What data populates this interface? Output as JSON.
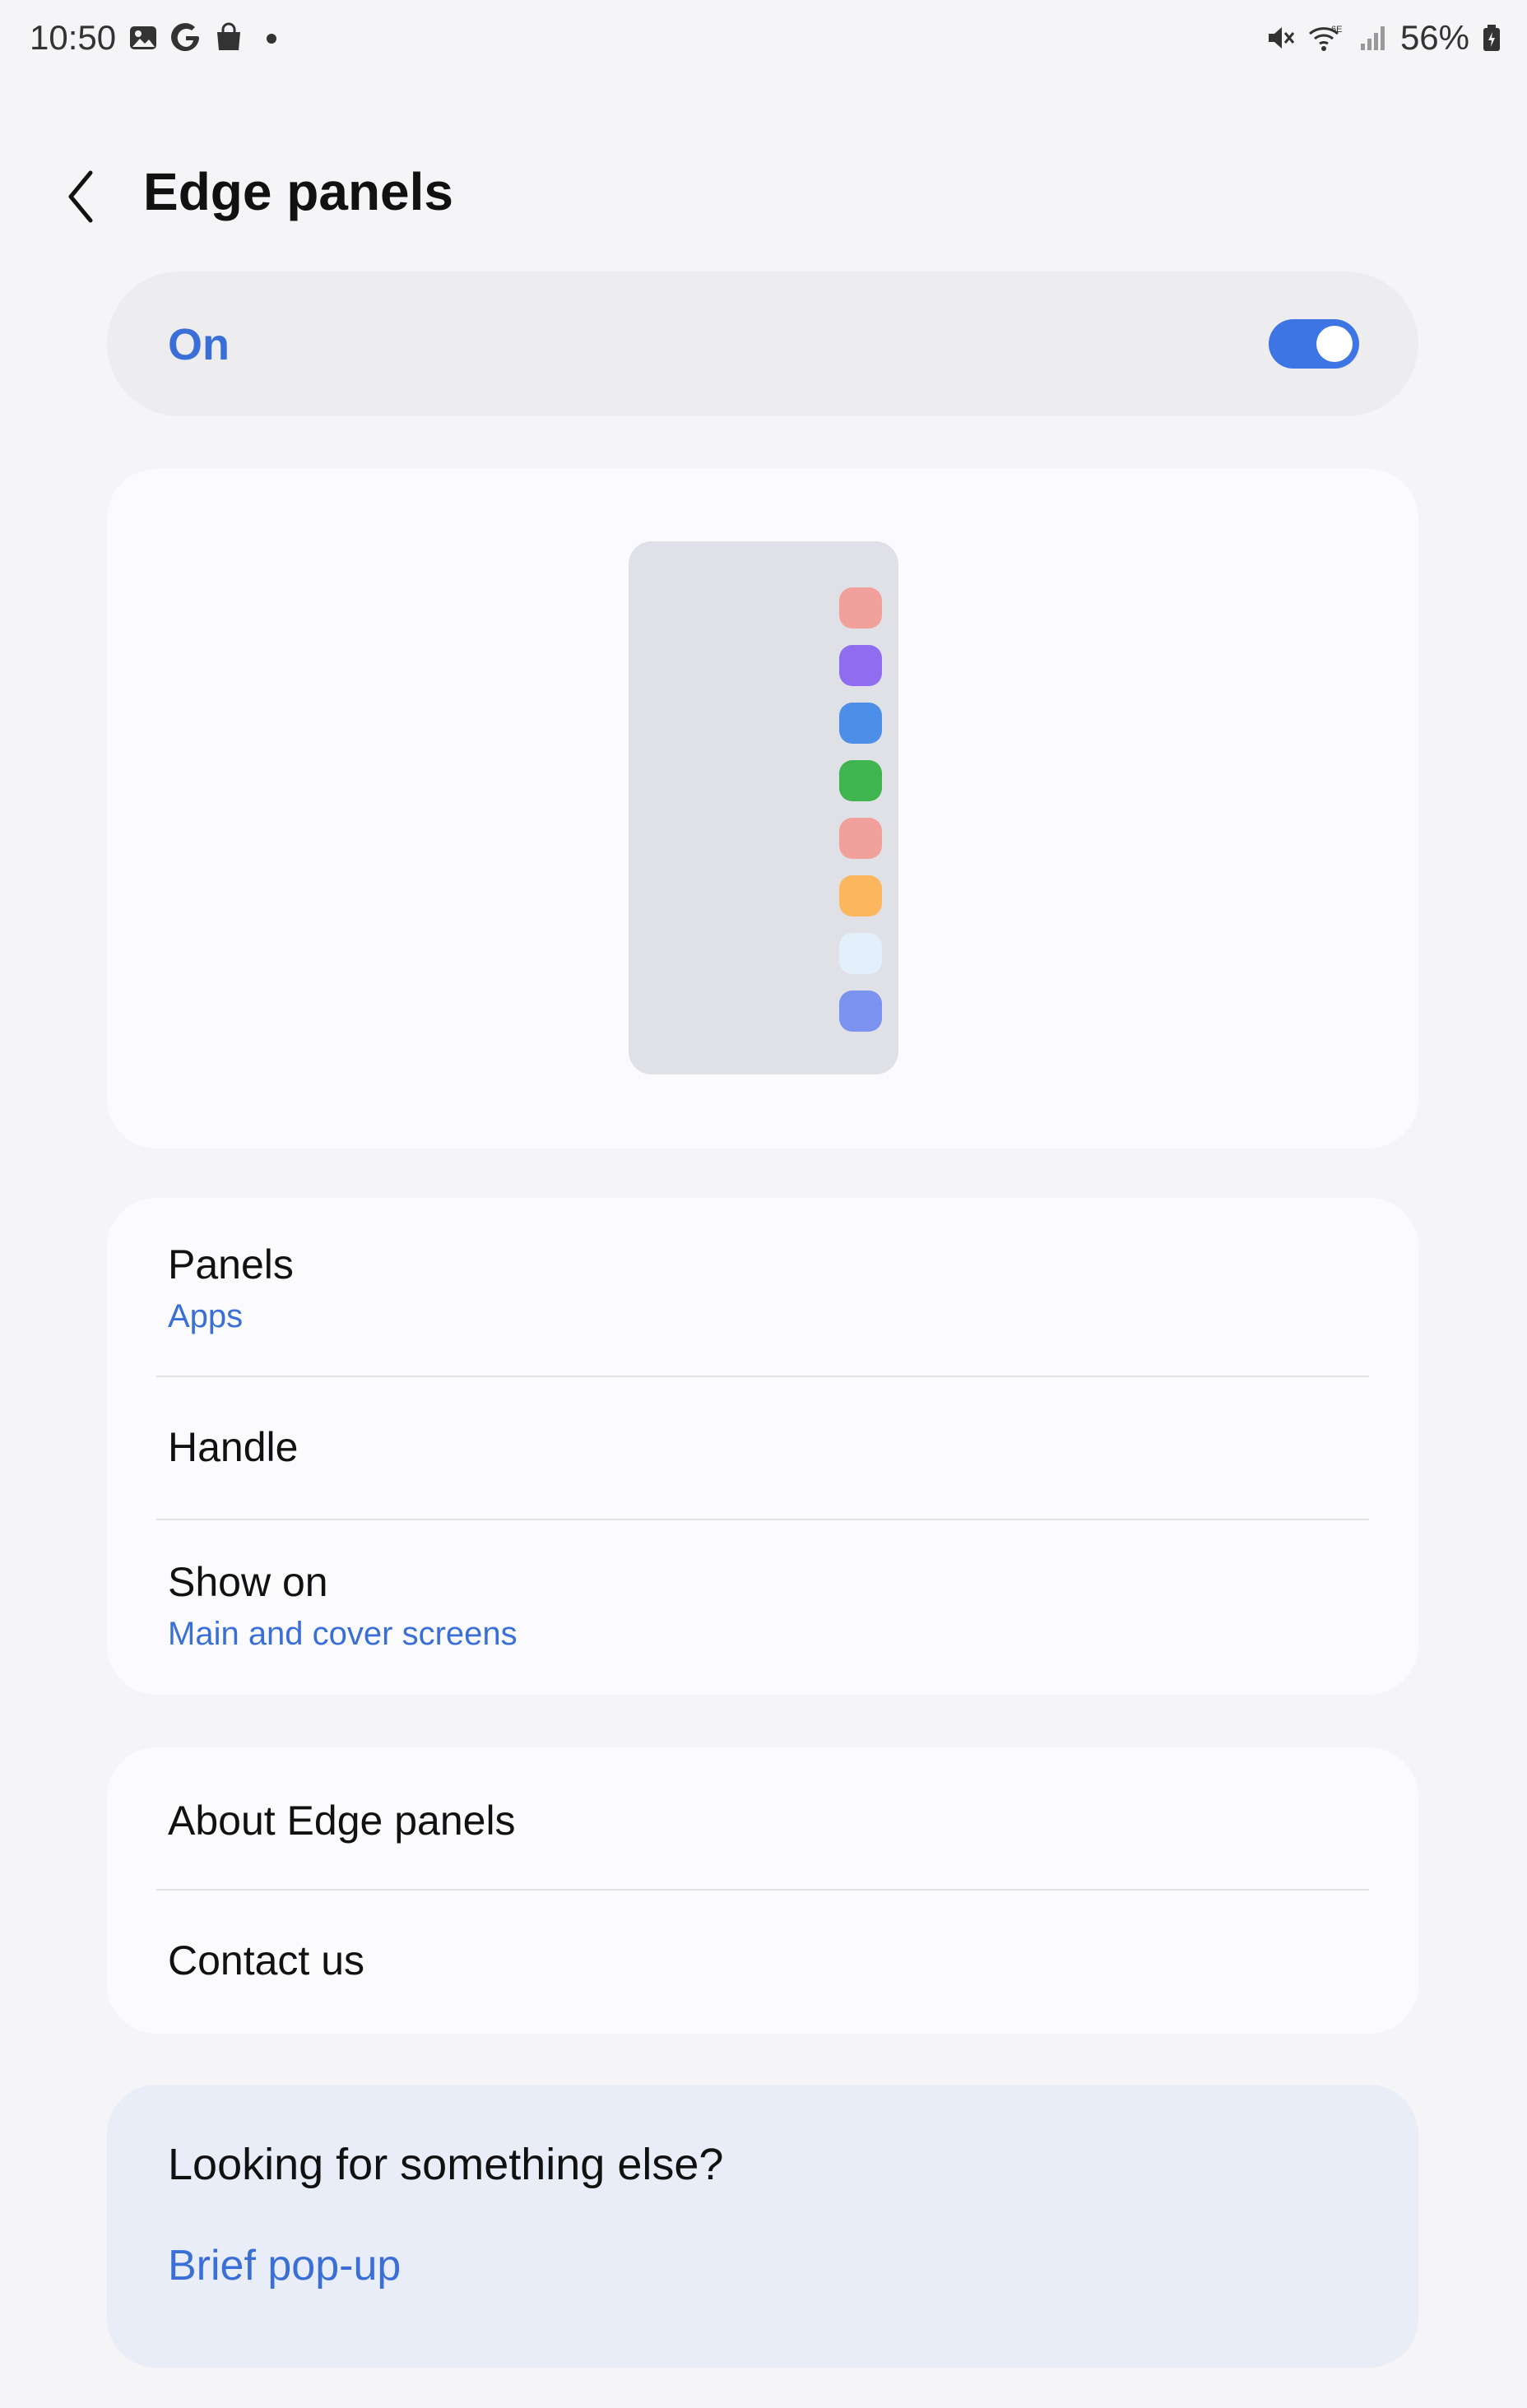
{
  "status_bar": {
    "time": "10:50",
    "battery": "56%",
    "left_icons": [
      "image-icon",
      "google-icon",
      "shopping-bag-icon",
      "dot-icon"
    ],
    "right_icons": [
      "mute-icon",
      "wifi-6e-icon",
      "signal-icon",
      "battery-icon"
    ]
  },
  "header": {
    "title": "Edge panels"
  },
  "master_switch": {
    "label": "On",
    "state": "on",
    "accent": "#3e75e5"
  },
  "preview": {
    "dot_colors": [
      "#f2a09b",
      "#8f6cf0",
      "#4d8fe8",
      "#3fb44f",
      "#f2a09b",
      "#fcb75e",
      "#e3f0fb",
      "#7b93ee"
    ]
  },
  "menu": {
    "panels": {
      "title": "Panels",
      "subtitle": "Apps"
    },
    "handle": {
      "title": "Handle"
    },
    "show_on": {
      "title": "Show on",
      "subtitle": "Main and cover screens"
    },
    "about": {
      "title": "About Edge panels"
    },
    "contact": {
      "title": "Contact us"
    }
  },
  "suggestion": {
    "title": "Looking for something else?",
    "link": "Brief pop-up"
  }
}
